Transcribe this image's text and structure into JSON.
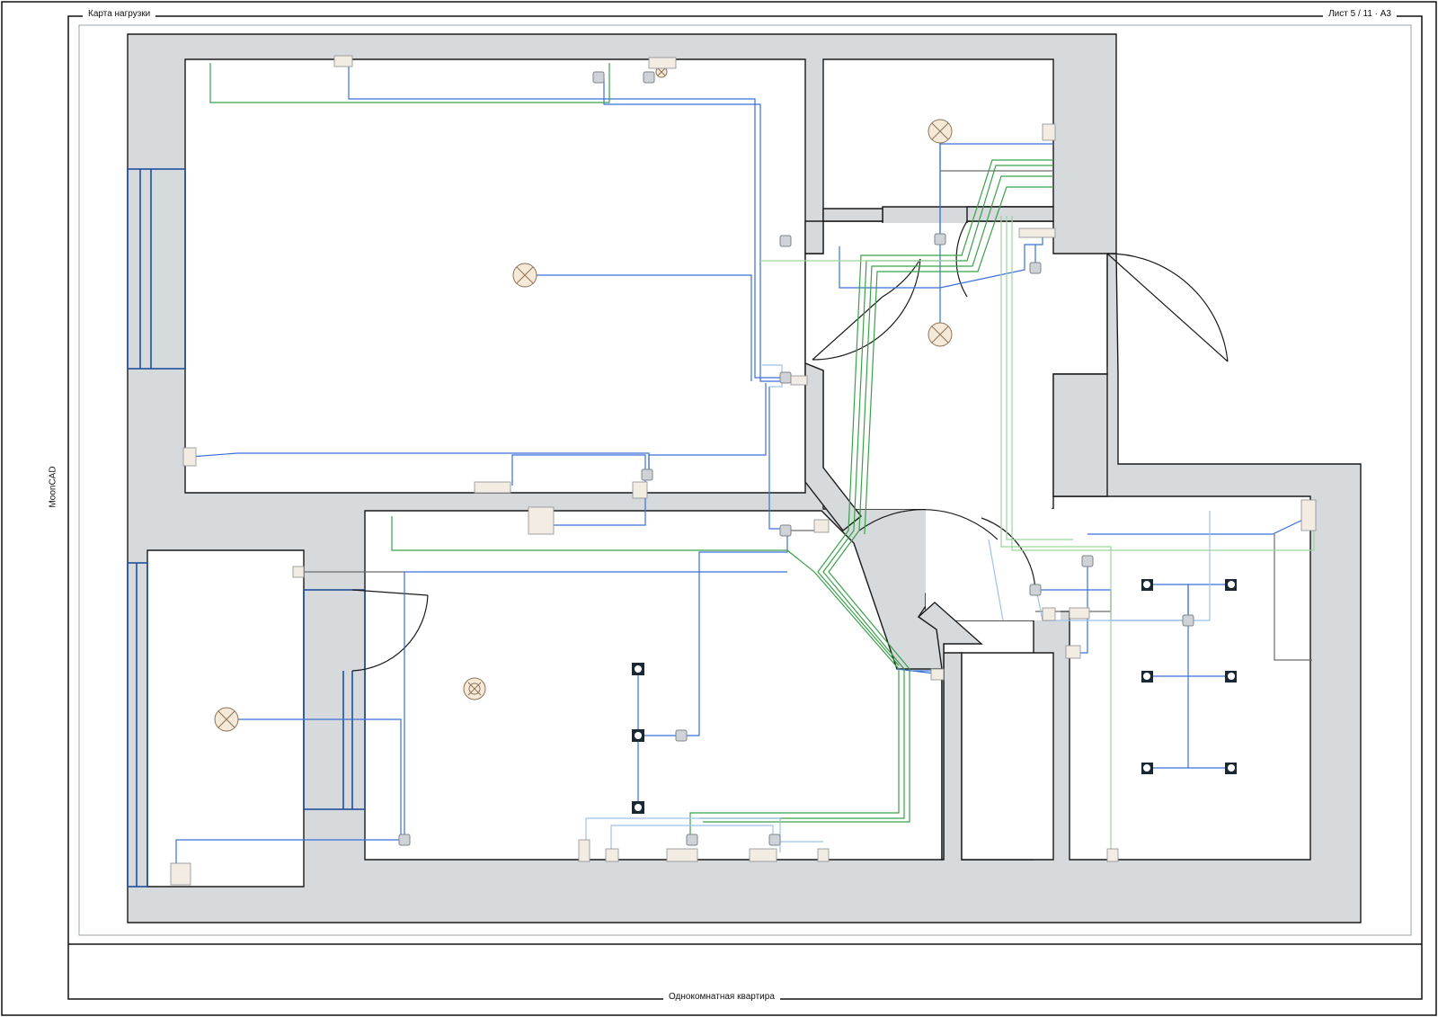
{
  "sheet": {
    "title": "Карта нагрузки",
    "page_info": "Лист 5 / 11 · А3",
    "app_name": "MoonCAD",
    "project_name": "Однокомнатная квартира"
  },
  "colors": {
    "wall_fill": "#d6dadd",
    "outline": "#1a1a1a",
    "cable_blue": "#3b6fd8",
    "cable_light_blue": "#9fc2ea",
    "cable_green": "#3aa04a",
    "cable_light_green": "#9ed39f",
    "cable_gray": "#6c6c6c",
    "window_blue": "#1f4f9c",
    "lamp_fill": "#f6e9d7",
    "socket_fill": "#f2ece2"
  },
  "symbols": {
    "ceiling_lamp": "ceiling-lamp-icon",
    "spot_light": "spot-light-icon",
    "junction_box": "junction-box-icon",
    "socket": "socket-icon",
    "switch": "switch-icon",
    "distribution_panel": "distribution-panel-icon"
  }
}
